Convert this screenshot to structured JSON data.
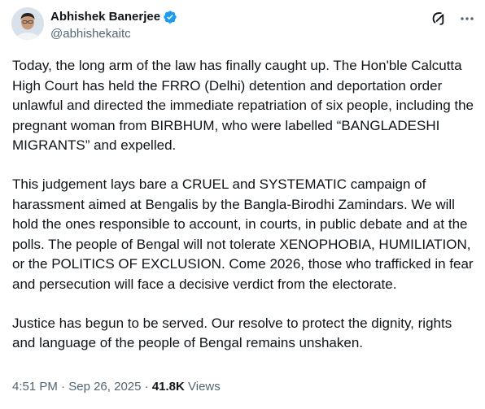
{
  "author": {
    "name": "Abhishek Banerjee",
    "handle": "@abhishekaitc"
  },
  "tweet": {
    "paragraphs": [
      "Today, the long arm of the law has finally caught up. The Hon'ble Calcutta High Court has held the FRRO (Delhi) detention and deportation order unlawful and directed the immediate repatriation of six people, including the pregnant woman from BIRBHUM, who were labelled “BANGLADESHI MIGRANTS” and expelled.",
      "This judgement lays bare a CRUEL and SYSTEMATIC campaign of harassment aimed at Bengalis by the Bangla-Birodhi Zamindars. We will hold the ones responsible to account, in courts, in public debate and at the polls. The people of Bengal will not tolerate XENOPHOBIA, HUMILIATION, or the POLITICS OF EXCLUSION. Come 2026, those who trafficked in fear and persecution will face a decisive verdict from the electorate.",
      "Justice has begun to be served. Our resolve to protect the dignity, rights and language of the people of Bengal remains unshaken."
    ]
  },
  "meta": {
    "time": "4:51 PM",
    "separator": "·",
    "date": "Sep 26, 2025",
    "views_count": "41.8K",
    "views_label": "Views"
  },
  "icons": {
    "verified": "verified-badge-icon",
    "grok": "grok-icon",
    "more": "more-options-icon"
  },
  "colors": {
    "text_primary": "#0f1419",
    "text_secondary": "#536471",
    "verified_blue": "#1d9bf0"
  }
}
